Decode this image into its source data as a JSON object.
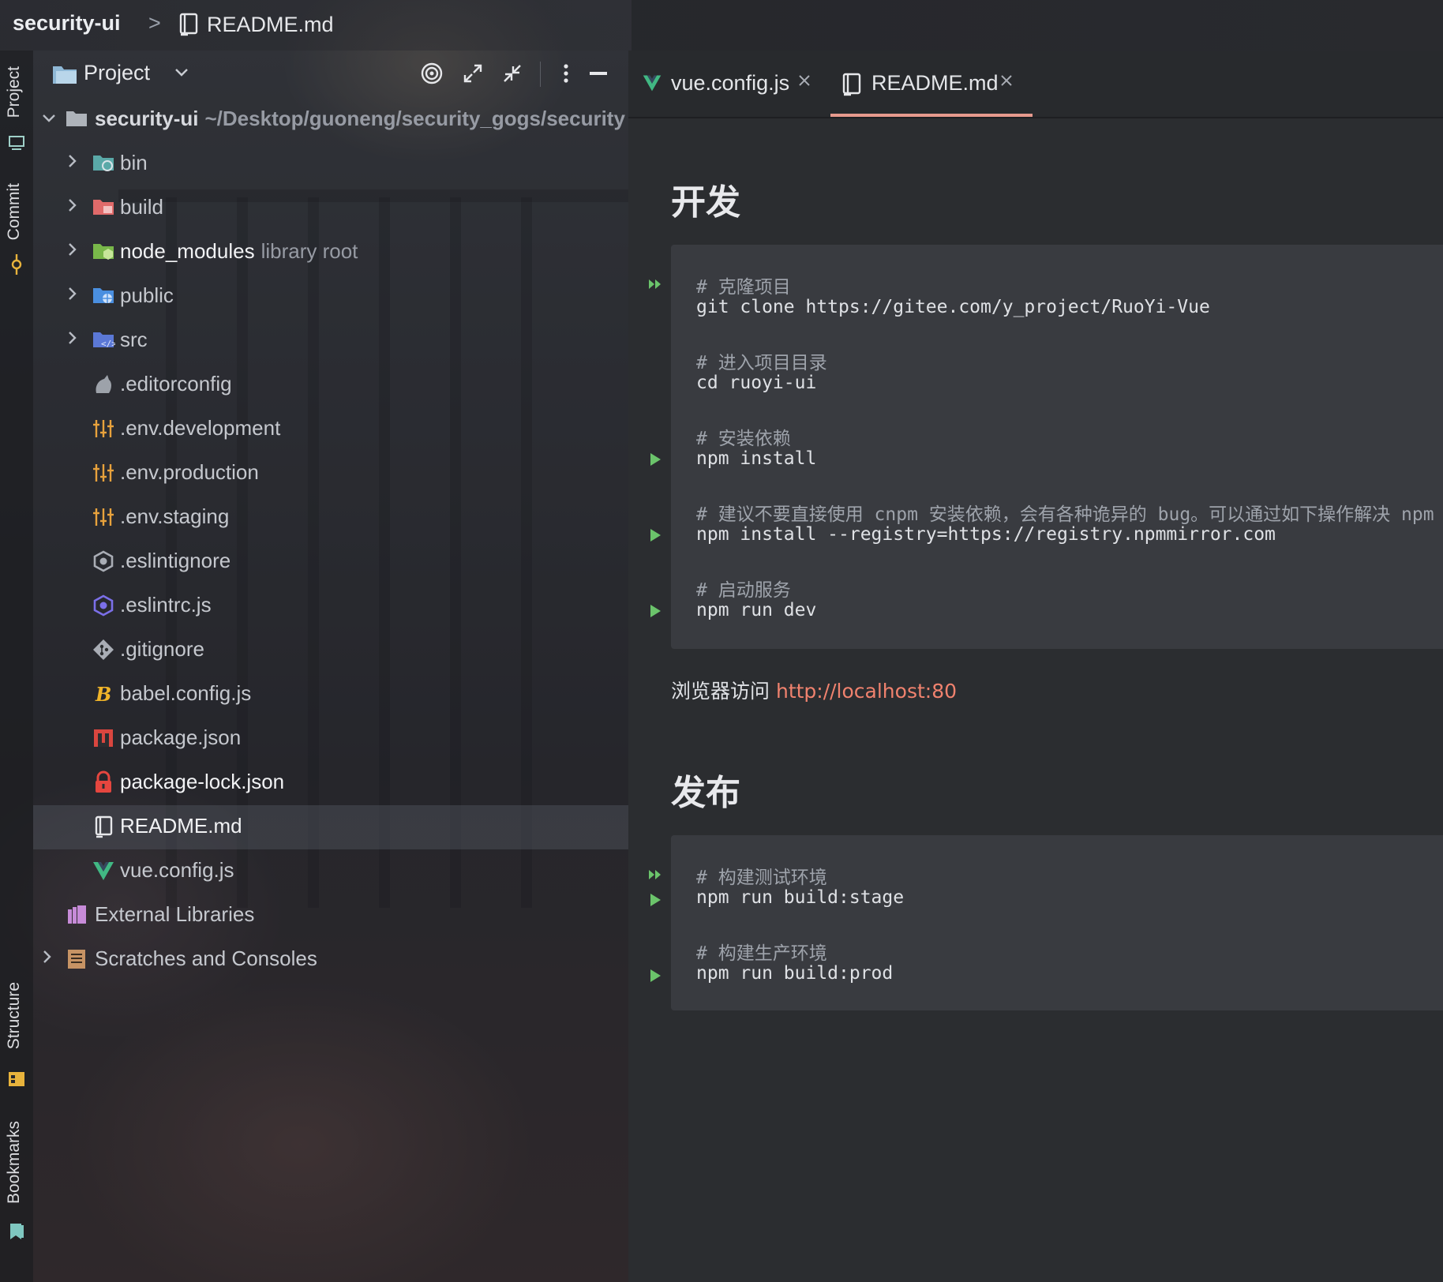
{
  "breadcrumb": {
    "project": "security-ui",
    "separator": ">",
    "file": "README.md"
  },
  "toolstrip": {
    "project_tab": "Project",
    "commit_tab": "Commit",
    "structure_tab": "Structure",
    "bookmarks_tab": "Bookmarks"
  },
  "project_panel": {
    "title": "Project",
    "root": {
      "name": "security-ui",
      "path": "~/Desktop/guoneng/security_gogs/security"
    },
    "items": [
      {
        "label": "bin",
        "icon": "folder-bin-icon"
      },
      {
        "label": "build",
        "icon": "folder-build-icon"
      },
      {
        "label": "node_modules",
        "suffix": "library root",
        "icon": "folder-node-modules-icon"
      },
      {
        "label": "public",
        "icon": "folder-public-icon"
      },
      {
        "label": "src",
        "icon": "folder-src-icon"
      },
      {
        "label": ".editorconfig",
        "icon": "editorconfig-icon"
      },
      {
        "label": ".env.development",
        "icon": "env-icon"
      },
      {
        "label": ".env.production",
        "icon": "env-icon"
      },
      {
        "label": ".env.staging",
        "icon": "env-icon"
      },
      {
        "label": ".eslintignore",
        "icon": "eslint-ignore-icon"
      },
      {
        "label": ".eslintrc.js",
        "icon": "eslint-icon"
      },
      {
        "label": ".gitignore",
        "icon": "git-icon"
      },
      {
        "label": "babel.config.js",
        "icon": "babel-icon"
      },
      {
        "label": "package.json",
        "icon": "npm-icon"
      },
      {
        "label": "package-lock.json",
        "icon": "lock-icon"
      },
      {
        "label": "README.md",
        "icon": "markdown-icon"
      },
      {
        "label": "vue.config.js",
        "icon": "vue-icon"
      }
    ],
    "external_libraries": "External Libraries",
    "scratches": "Scratches and Consoles"
  },
  "editor": {
    "tabs": [
      {
        "label": "vue.config.js",
        "icon": "vue-icon",
        "active": false
      },
      {
        "label": "README.md",
        "icon": "markdown-icon",
        "active": true
      }
    ],
    "sections": [
      {
        "heading": "开发",
        "code": [
          {
            "text": "# 克隆项目",
            "comment": true
          },
          {
            "text": "git clone https://gitee.com/y_project/RuoYi-Vue",
            "comment": false
          },
          {
            "text": "# 进入项目目录",
            "comment": true
          },
          {
            "text": "cd ruoyi-ui",
            "comment": false
          },
          {
            "text": "# 安装依赖",
            "comment": true
          },
          {
            "text": "npm install",
            "comment": false
          },
          {
            "text": "# 建议不要直接使用 cnpm 安装依赖，会有各种诡异的 bug。可以通过如下操作解决 npm 下载",
            "comment": true
          },
          {
            "text": "npm install --registry=https://registry.npmmirror.com",
            "comment": false
          },
          {
            "text": "# 启动服务",
            "comment": true
          },
          {
            "text": "npm run dev",
            "comment": false
          }
        ]
      },
      {
        "heading": "发布",
        "code": [
          {
            "text": "# 构建测试环境",
            "comment": true
          },
          {
            "text": "npm run build:stage",
            "comment": false
          },
          {
            "text": "# 构建生产环境",
            "comment": true
          },
          {
            "text": "npm run build:prod",
            "comment": false
          }
        ]
      }
    ],
    "browser_text": "浏览器访问",
    "browser_link": "http://localhost:80"
  },
  "colors": {
    "accent": "#e79a8e",
    "link": "#f0826e",
    "run_icon": "#6bc46b"
  }
}
